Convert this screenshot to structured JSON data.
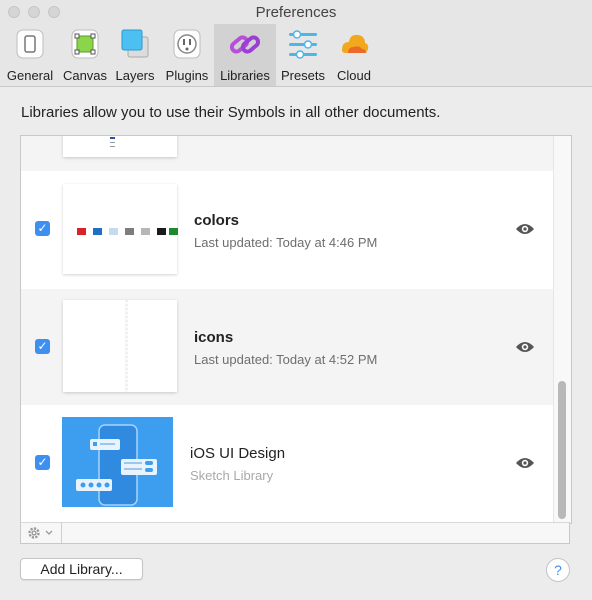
{
  "window": {
    "title": "Preferences"
  },
  "toolbar": {
    "items": [
      {
        "label": "General",
        "icon": "general-icon"
      },
      {
        "label": "Canvas",
        "icon": "canvas-icon"
      },
      {
        "label": "Layers",
        "icon": "layers-icon"
      },
      {
        "label": "Plugins",
        "icon": "plugins-icon"
      },
      {
        "label": "Libraries",
        "icon": "libraries-icon",
        "selected": true
      },
      {
        "label": "Presets",
        "icon": "presets-icon"
      },
      {
        "label": "Cloud",
        "icon": "cloud-icon"
      }
    ]
  },
  "description": "Libraries allow you to use their Symbols in all other documents.",
  "libraries": [
    {
      "name": "colors",
      "subtitle": "Last updated: Today at 4:46 PM",
      "enabled": true,
      "swatches": [
        "#d8232a",
        "#1f6fc4",
        "#c5dbef",
        "#7d7d7d",
        "#b7b7b7",
        "#1a1a1a",
        "#1f8a2c"
      ]
    },
    {
      "name": "icons",
      "subtitle": "Last updated: Today at 4:52 PM",
      "enabled": true
    },
    {
      "name": "iOS UI Design",
      "subtitle": "Sketch Library",
      "enabled": true
    }
  ],
  "footer": {
    "add_library_label": "Add Library...",
    "help_label": "?"
  },
  "colors": {
    "accent": "#3d8ff0",
    "ios_thumb_bg": "#3d9ef0"
  }
}
